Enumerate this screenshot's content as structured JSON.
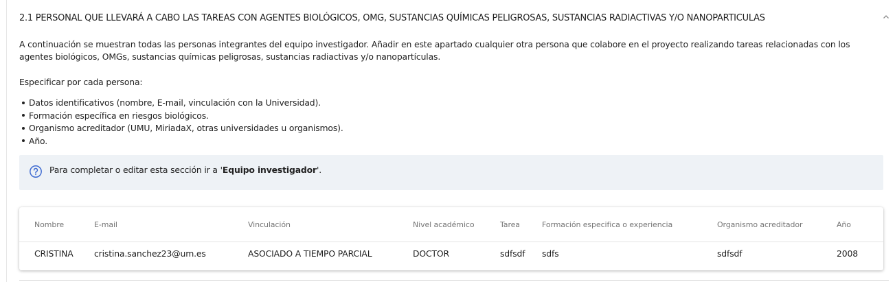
{
  "section": {
    "title": "2.1 PERSONAL QUE LLEVARÁ A CABO LAS TAREAS CON AGENTES BIOLÓGICOS, OMG, SUSTANCIAS QUÍMICAS PELIGROSAS, SUSTANCIAS RADIACTIVAS Y/O NANOPARTICULAS",
    "collapse_icon": "chevron-up-icon"
  },
  "intro": {
    "paragraph": "A continuación se muestran todas las personas integrantes del equipo investigador. Añadir en este apartado cualquier otra persona que colabore en el proyecto realizando tareas relacionadas con los agentes biológicos, OMGs, sustancias químicas peligrosas, sustancias radiactivas y/o nanopartículas.",
    "spec_intro": "Especificar por cada persona:",
    "bullets": [
      "Datos identificativos (nombre, E-mail, vinculación con la Universidad).",
      "Formación específica en riesgos biológicos.",
      "Organismo acreditador (UMU, MiriadaX, otras universidades u organismos).",
      "Año."
    ]
  },
  "info": {
    "icon": "help-circle-icon",
    "text_before": "Para completar o editar esta sección ir a '",
    "link_text": "Equipo investigador",
    "text_after": "'.",
    "accent_color": "#3f6bd1"
  },
  "table": {
    "headers": {
      "nombre": "Nombre",
      "email": "E-mail",
      "vinculacion": "Vinculación",
      "nivel": "Nivel académico",
      "tarea": "Tarea",
      "formacion": "Formación especifica o experiencia",
      "organismo": "Organismo acreditador",
      "anio": "Año"
    },
    "rows": [
      {
        "nombre": "CRISTINA",
        "email": "cristina.sanchez23@um.es",
        "vinculacion": "ASOCIADO A TIEMPO PARCIAL",
        "nivel": "DOCTOR",
        "tarea": "sdfsdf",
        "formacion": "sdfs",
        "organismo": "sdfsdf",
        "anio": "2008"
      }
    ]
  }
}
